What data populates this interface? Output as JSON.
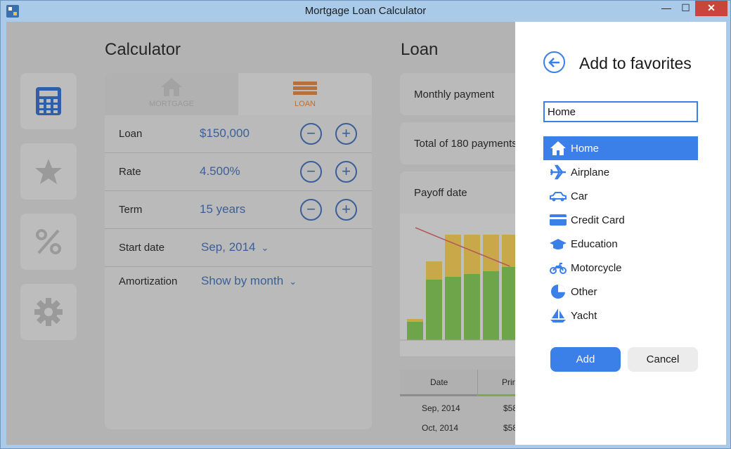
{
  "window": {
    "title": "Mortgage Loan Calculator",
    "minimize": "—",
    "maximize": "☐",
    "close": "✕"
  },
  "nav": [
    {
      "icon": "calculator-icon",
      "selected": true
    },
    {
      "icon": "star-icon",
      "selected": false
    },
    {
      "icon": "percent-icon",
      "selected": false
    },
    {
      "icon": "gear-icon",
      "selected": false
    }
  ],
  "calculator": {
    "heading": "Calculator",
    "tabs": [
      {
        "label": "MORTGAGE"
      },
      {
        "label": "LOAN"
      }
    ],
    "rows": {
      "loan": {
        "label": "Loan",
        "value": "$150,000"
      },
      "rate": {
        "label": "Rate",
        "value": "4.500%"
      },
      "term": {
        "label": "Term",
        "value": "15 years"
      },
      "start_date": {
        "label": "Start date",
        "value": "Sep, 2014"
      },
      "amortization": {
        "label": "Amortization",
        "value": "Show by month"
      }
    }
  },
  "loan": {
    "heading": "Loan",
    "monthly_payment": "Monthly payment",
    "total_payments": "Total of 180 payments",
    "payoff_date": "Payoff date",
    "table": {
      "headers": [
        "Date",
        "Prin"
      ],
      "rows": [
        [
          "Sep, 2014",
          "$58"
        ],
        [
          "Oct, 2014",
          "$58"
        ]
      ]
    }
  },
  "chart_data": {
    "type": "bar",
    "series": [
      {
        "name": "orange",
        "values": [
          30,
          112,
          150,
          150,
          150,
          150
        ]
      },
      {
        "name": "green",
        "values": [
          26,
          86,
          90,
          94,
          98,
          104
        ]
      }
    ]
  },
  "favorites_dialog": {
    "title": "Add to favorites",
    "name_value": "Home",
    "categories": [
      {
        "label": "Home",
        "icon": "home-icon",
        "selected": true
      },
      {
        "label": "Airplane",
        "icon": "airplane-icon",
        "selected": false
      },
      {
        "label": "Car",
        "icon": "car-icon",
        "selected": false
      },
      {
        "label": "Credit Card",
        "icon": "credit-card-icon",
        "selected": false
      },
      {
        "label": "Education",
        "icon": "education-icon",
        "selected": false
      },
      {
        "label": "Motorcycle",
        "icon": "motorcycle-icon",
        "selected": false
      },
      {
        "label": "Other",
        "icon": "pie-chart-icon",
        "selected": false
      },
      {
        "label": "Yacht",
        "icon": "sailboat-icon",
        "selected": false
      }
    ],
    "add_label": "Add",
    "cancel_label": "Cancel"
  },
  "colors": {
    "accent": "#3b7fe8",
    "value_text": "#3b5f96",
    "loan_tab": "#b4703d"
  }
}
